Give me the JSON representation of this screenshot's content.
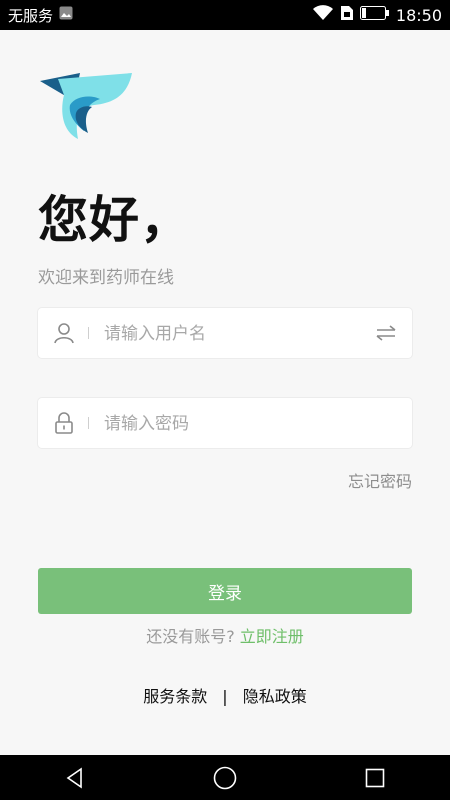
{
  "status_bar": {
    "carrier": "无服务",
    "time": "18:50"
  },
  "app": {
    "logo_colors": {
      "dark": "#1a5f8a",
      "mid": "#2a9bc8",
      "light": "#7fe0e8"
    }
  },
  "login": {
    "greeting": "您好，",
    "subtitle": "欢迎来到药师在线",
    "username_placeholder": "请输入用户名",
    "password_placeholder": "请输入密码",
    "forgot_password": "忘记密码",
    "login_button": "登录",
    "no_account_text": "还没有账号?",
    "register_link": "立即注册",
    "terms_link": "服务条款",
    "terms_separator": "|",
    "privacy_link": "隐私政策"
  },
  "colors": {
    "accent": "#79c07a",
    "link": "#6fbf6a"
  },
  "icons": {
    "user": "user-icon",
    "lock": "lock-icon",
    "switch": "switch-account-icon",
    "back": "back-triangle-icon",
    "home": "home-circle-icon",
    "recents": "recents-square-icon"
  }
}
